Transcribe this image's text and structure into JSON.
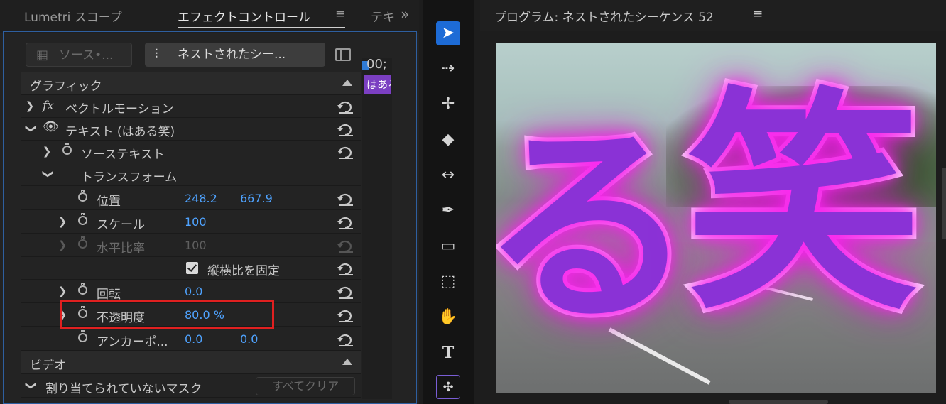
{
  "tabs": {
    "lumetri": "Lumetri スコープ",
    "effect_controls": "エフェクトコントロール",
    "text_tab": "テキ",
    "menu": "≡",
    "overflow": "»"
  },
  "clip_selector": {
    "master": "ソース•...",
    "sequence": "ネストされたシー...",
    "timeline_time": "00;",
    "timeline_clip": "はある"
  },
  "sections": {
    "graphic": "グラフィック",
    "video": "ビデオ"
  },
  "rows": {
    "vector_motion": "ベクトルモーション",
    "fx_label": "fx",
    "text_layer": "テキスト (はある笑)",
    "source_text": "ソーステキスト",
    "transform": "トランスフォーム",
    "position": {
      "label": "位置",
      "x": "248.2",
      "y": "667.9"
    },
    "scale": {
      "label": "スケール",
      "value": "100"
    },
    "h_ratio": {
      "label": "水平比率",
      "value": "100"
    },
    "lock_ratio": "縦横比を固定",
    "rotation": {
      "label": "回転",
      "value": "0.0"
    },
    "opacity": {
      "label": "不透明度",
      "value": "80.0 %"
    },
    "anchor": {
      "label": "アンカーポ...",
      "x": "0.0",
      "y": "0.0"
    },
    "unassigned_mask": "割り当てられていないマスク",
    "clear_all": "すべてクリア"
  },
  "program": {
    "title": "プログラム: ネストされたシーケンス 52",
    "menu": "≡",
    "video_chars": [
      "る",
      "笑"
    ]
  },
  "tools": [
    "selection-tool",
    "track-select-tool",
    "ripple-edit-tool",
    "razor-tool",
    "slip-tool",
    "pen-tool",
    "rectangle-tool",
    "frame-tool",
    "hand-tool",
    "type-tool",
    "captions-tool"
  ],
  "colors": {
    "accent_blue": "#4fa3ff",
    "highlight_red": "#e02020",
    "clip_purple": "#7b3fc2",
    "glow_magenta": "#ff2cf2"
  }
}
